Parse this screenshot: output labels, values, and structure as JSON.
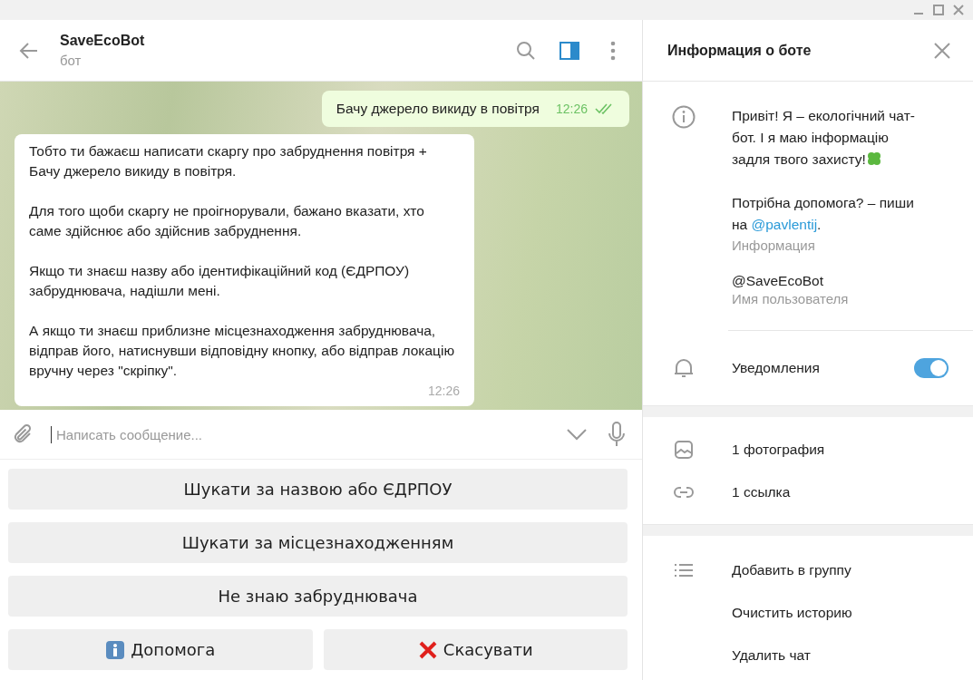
{
  "chat": {
    "title": "SaveEcoBot",
    "subtitle": "бот",
    "messages": [
      {
        "kind": "outgoing",
        "paragraphs": [
          "Бачу джерело викиду в повітря"
        ],
        "time": "12:26",
        "read": true
      },
      {
        "kind": "incoming",
        "paragraphs": [
          "Тобто ти бажаєш написати скаргу про забруднення повітря + Бачу джерело викиду в повітря.",
          "Для того щоби скаргу не проігнорували, бажано вказати, хто саме здійснює або здійснив забруднення.",
          "Якщо ти знаєш назву або ідентифікаційний код (ЄДРПОУ) забруднювача, надішли мені.",
          "А якщо ти знаєш приблизне місцезнаходження забруднювача, відправ його, натиснувши відповідну кнопку, або відправ локацію вручну через \"скріпку\"."
        ],
        "time": "12:26"
      }
    ],
    "input": {
      "placeholder": "Написать сообщение..."
    },
    "keyboard": [
      [
        {
          "label": "Шукати за назвою або ЄДРПОУ"
        }
      ],
      [
        {
          "label": "Шукати за місцезнаходженням"
        }
      ],
      [
        {
          "label": "Не знаю забруднювача"
        }
      ],
      [
        {
          "label": "Допомога",
          "kind": "help"
        },
        {
          "label": "Скасувати",
          "kind": "cancel"
        }
      ]
    ]
  },
  "info_panel": {
    "title": "Информация о боте",
    "bio": {
      "lines": [
        "Привіт! Я – екологічний чат-бот. І я маю інформацію задля твого захисту!"
      ],
      "help_text": "Потрібна допомога? – пиши на",
      "help_link": "@pavlentij",
      "help_end": ".",
      "caption": "Информация"
    },
    "username": {
      "value": "@SaveEcoBot",
      "caption": "Имя пользователя"
    },
    "notifications": {
      "label": "Уведомления",
      "on": true
    },
    "media": [
      {
        "kind": "photo",
        "label": "1 фотография"
      },
      {
        "kind": "link",
        "label": "1 ссылка"
      }
    ],
    "actions": [
      {
        "label": "Добавить в группу",
        "icon": true
      },
      {
        "label": "Очистить историю",
        "icon": false
      },
      {
        "label": "Удалить чат",
        "icon": false
      }
    ]
  }
}
